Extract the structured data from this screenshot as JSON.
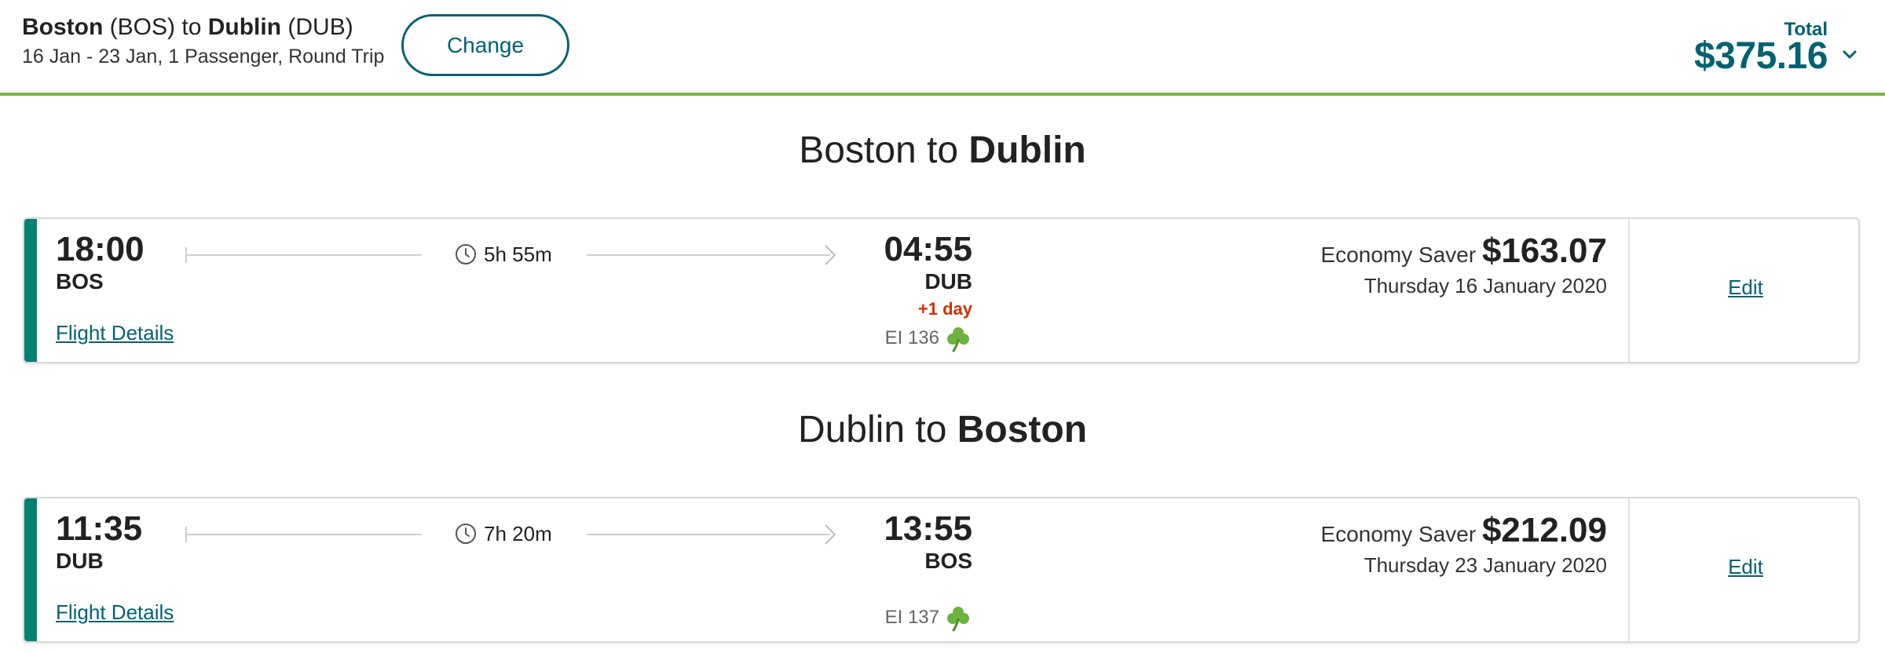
{
  "header": {
    "origin_city": "Boston",
    "origin_code": "(BOS)",
    "connector": "to",
    "destination_city": "Dublin",
    "destination_code": "(DUB)",
    "trip_summary": "16 Jan - 23 Jan, 1 Passenger, Round Trip",
    "change_label": "Change",
    "total_label": "Total",
    "total_amount": "$375.16",
    "toggle_icon": "chevron-down-icon"
  },
  "colors": {
    "brand_teal": "#006272",
    "stripe_green": "#008272",
    "header_rule": "#7ab648",
    "next_day_red": "#cc3300",
    "shamrock_green": "#6cb33f"
  },
  "flights": [
    {
      "heading_from": "Boston",
      "heading_to_word": "to",
      "heading_to": "Dublin",
      "dep_time": "18:00",
      "dep_code": "BOS",
      "duration": "5h 55m",
      "arr_time": "04:55",
      "arr_code": "DUB",
      "next_day": "+1 day",
      "flight_number": "EI 136",
      "fare_class": "Economy Saver",
      "price": "$163.07",
      "date": "Thursday 16 January 2020",
      "details_label": "Flight Details",
      "edit_label": "Edit"
    },
    {
      "heading_from": "Dublin",
      "heading_to_word": "to",
      "heading_to": "Boston",
      "dep_time": "11:35",
      "dep_code": "DUB",
      "duration": "7h 20m",
      "arr_time": "13:55",
      "arr_code": "BOS",
      "next_day": "",
      "flight_number": "EI 137",
      "fare_class": "Economy Saver",
      "price": "$212.09",
      "date": "Thursday 23 January 2020",
      "details_label": "Flight Details",
      "edit_label": "Edit"
    }
  ]
}
